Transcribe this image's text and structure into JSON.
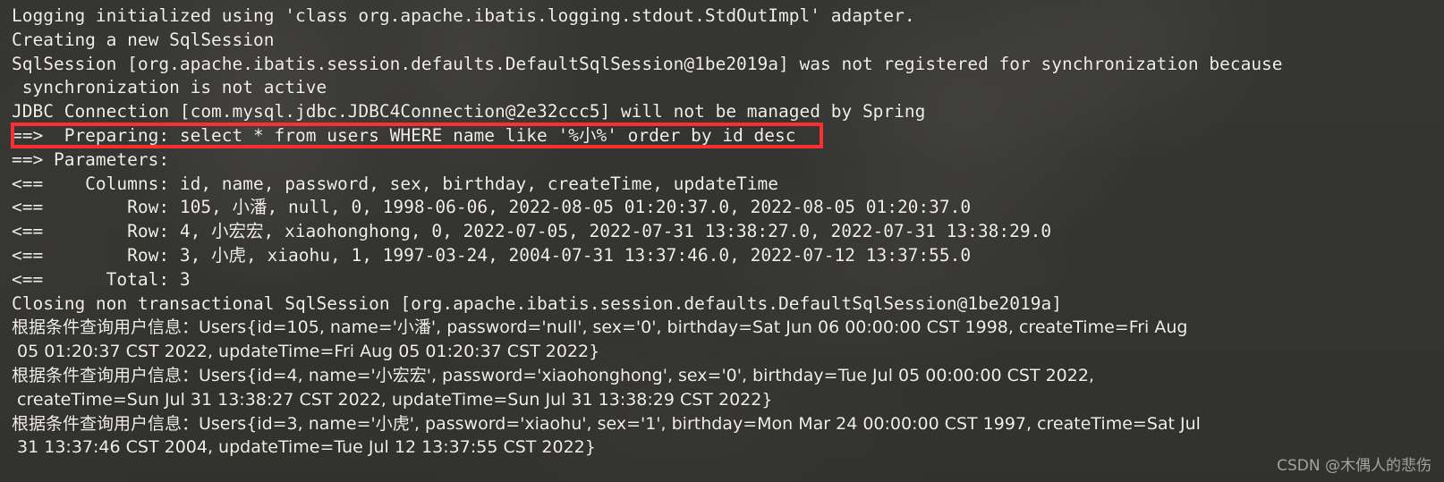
{
  "console": {
    "background_color": "#3b3b38",
    "text_color": "#f2efe9",
    "highlight_color": "#fb2f2f",
    "lines": [
      {
        "id": "log-line-1",
        "cjk": false,
        "text": "Logging initialized using 'class org.apache.ibatis.logging.stdout.StdOutImpl' adapter."
      },
      {
        "id": "log-line-2",
        "cjk": false,
        "text": "Creating a new SqlSession"
      },
      {
        "id": "log-line-3",
        "cjk": false,
        "text": "SqlSession [org.apache.ibatis.session.defaults.DefaultSqlSession@1be2019a] was not registered for synchronization because"
      },
      {
        "id": "log-line-4",
        "cjk": false,
        "text": " synchronization is not active"
      },
      {
        "id": "log-line-5",
        "cjk": false,
        "text": "JDBC Connection [com.mysql.jdbc.JDBC4Connection@2e32ccc5] will not be managed by Spring"
      },
      {
        "id": "log-line-6",
        "cjk": false,
        "text": "==>  Preparing: select * from users WHERE name like '%小%' order by id desc"
      },
      {
        "id": "log-line-7",
        "cjk": false,
        "text": "==> Parameters: "
      },
      {
        "id": "log-line-8",
        "cjk": false,
        "text": "<==    Columns: id, name, password, sex, birthday, createTime, updateTime"
      },
      {
        "id": "log-line-9",
        "cjk": false,
        "text": "<==        Row: 105, 小潘, null, 0, 1998-06-06, 2022-08-05 01:20:37.0, 2022-08-05 01:20:37.0"
      },
      {
        "id": "log-line-10",
        "cjk": false,
        "text": "<==        Row: 4, 小宏宏, xiaohonghong, 0, 2022-07-05, 2022-07-31 13:38:27.0, 2022-07-31 13:38:29.0"
      },
      {
        "id": "log-line-11",
        "cjk": false,
        "text": "<==        Row: 3, 小虎, xiaohu, 1, 1997-03-24, 2004-07-31 13:37:46.0, 2022-07-12 13:37:55.0"
      },
      {
        "id": "log-line-12",
        "cjk": false,
        "text": "<==      Total: 3"
      },
      {
        "id": "log-line-13",
        "cjk": false,
        "text": "Closing non transactional SqlSession [org.apache.ibatis.session.defaults.DefaultSqlSession@1be2019a]"
      },
      {
        "id": "log-line-14",
        "cjk": true,
        "text": "根据条件查询用户信息：Users{id=105, name='小潘', password='null', sex='0', birthday=Sat Jun 06 00:00:00 CST 1998, createTime=Fri Aug"
      },
      {
        "id": "log-line-15",
        "cjk": true,
        "text": " 05 01:20:37 CST 2022, updateTime=Fri Aug 05 01:20:37 CST 2022}"
      },
      {
        "id": "log-line-16",
        "cjk": true,
        "text": "根据条件查询用户信息：Users{id=4, name='小宏宏', password='xiaohonghong', sex='0', birthday=Tue Jul 05 00:00:00 CST 2022,"
      },
      {
        "id": "log-line-17",
        "cjk": true,
        "text": " createTime=Sun Jul 31 13:38:27 CST 2022, updateTime=Sun Jul 31 13:38:29 CST 2022}"
      },
      {
        "id": "log-line-18",
        "cjk": true,
        "text": "根据条件查询用户信息：Users{id=3, name='小虎', password='xiaohu', sex='1', birthday=Mon Mar 24 00:00:00 CST 1997, createTime=Sat Jul"
      },
      {
        "id": "log-line-19",
        "cjk": true,
        "text": " 31 13:37:46 CST 2004, updateTime=Tue Jul 12 13:37:55 CST 2022}"
      }
    ],
    "highlight": {
      "label": "sql-preparing-highlight",
      "line_index": 5
    },
    "watermark": "CSDN @木偶人的悲伤"
  }
}
